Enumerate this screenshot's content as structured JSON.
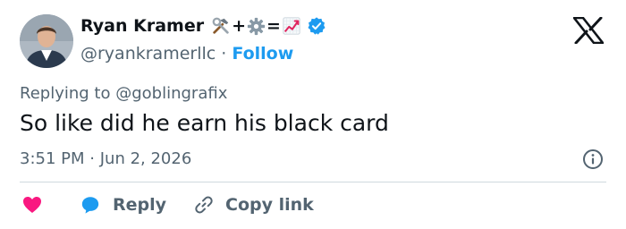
{
  "author": {
    "display_name": "Ryan Kramer",
    "name_emoji_icons": [
      "hammer-and-wrench-icon",
      "gear-icon",
      "chart-increasing-icon"
    ],
    "name_emoji_plus": "+",
    "name_emoji_equals": "=",
    "handle": "@ryankramerllc",
    "separator": "·",
    "follow_label": "Follow",
    "verified_color": "#1d9bf0",
    "avatar_icon": "avatar"
  },
  "tweet": {
    "replying_prefix": "Replying to",
    "replying_to": "@goblingrafix",
    "text": "So like did he earn his black card",
    "time": "3:51 PM",
    "date_separator": "·",
    "date": "Jun 2, 2026"
  },
  "actions": {
    "like_icon": "heart-icon",
    "like_color": "#f91880",
    "reply_label": "Reply",
    "reply_icon": "reply-bubble-icon",
    "reply_color": "#1d9bf0",
    "copy_label": "Copy link",
    "copy_icon": "link-icon"
  },
  "brand": {
    "logo": "x-logo-icon",
    "info_icon": "info-icon"
  }
}
